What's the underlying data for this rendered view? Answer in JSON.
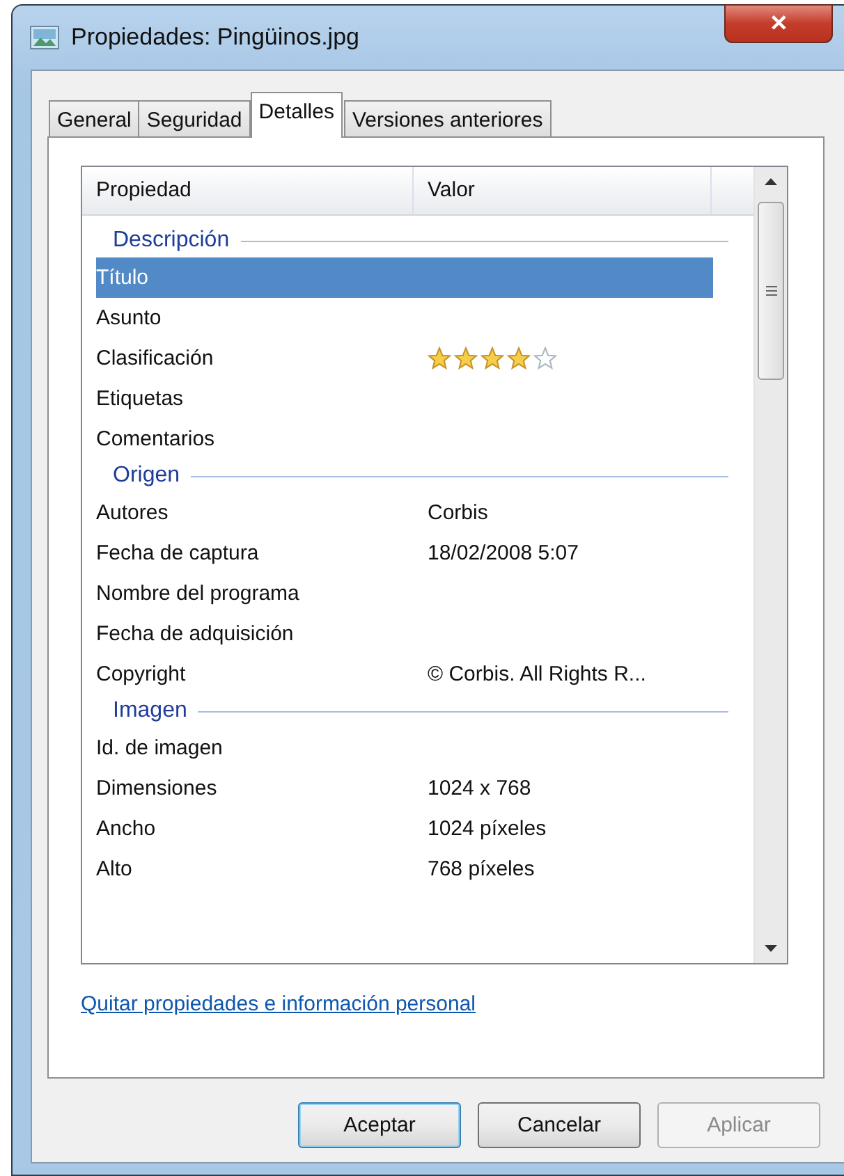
{
  "window": {
    "title": "Propiedades: Pingüinos.jpg",
    "close": "✕"
  },
  "tabs": [
    {
      "label": "General",
      "selected": false
    },
    {
      "label": "Seguridad",
      "selected": false
    },
    {
      "label": "Detalles",
      "selected": true
    },
    {
      "label": "Versiones anteriores",
      "selected": false
    }
  ],
  "table": {
    "columns": [
      "Propiedad",
      "Valor"
    ],
    "groups": [
      {
        "title": "Descripción",
        "rows": [
          {
            "kind": "text",
            "property": "Título",
            "value": "",
            "selected": true
          },
          {
            "kind": "text",
            "property": "Asunto",
            "value": "",
            "selected": false
          },
          {
            "kind": "rating",
            "property": "Clasificación",
            "stars": 4,
            "selected": false
          },
          {
            "kind": "text",
            "property": "Etiquetas",
            "value": "",
            "selected": false
          },
          {
            "kind": "text",
            "property": "Comentarios",
            "value": "",
            "selected": false
          }
        ]
      },
      {
        "title": "Origen",
        "rows": [
          {
            "kind": "text",
            "property": "Autores",
            "value": "Corbis",
            "selected": false
          },
          {
            "kind": "text",
            "property": "Fecha de captura",
            "value": "18/02/2008 5:07",
            "selected": false
          },
          {
            "kind": "text",
            "property": "Nombre del programa",
            "value": "",
            "selected": false
          },
          {
            "kind": "text",
            "property": "Fecha de adquisición",
            "value": "",
            "selected": false
          },
          {
            "kind": "text",
            "property": "Copyright",
            "value": "© Corbis.  All Rights R...",
            "selected": false
          }
        ]
      },
      {
        "title": "Imagen",
        "rows": [
          {
            "kind": "text",
            "property": "Id. de imagen",
            "value": "",
            "selected": false
          },
          {
            "kind": "text",
            "property": "Dimensiones",
            "value": "1024 x 768",
            "selected": false
          },
          {
            "kind": "text",
            "property": "Ancho",
            "value": "1024 píxeles",
            "selected": false
          },
          {
            "kind": "text",
            "property": "Alto",
            "value": "768 píxeles",
            "selected": false
          }
        ]
      }
    ]
  },
  "link": "Quitar propiedades e información personal",
  "buttons": [
    {
      "label": "Aceptar",
      "disabled": false,
      "default": true
    },
    {
      "label": "Cancelar",
      "disabled": false,
      "default": false
    },
    {
      "label": "Aplicar",
      "disabled": true,
      "default": false
    }
  ]
}
